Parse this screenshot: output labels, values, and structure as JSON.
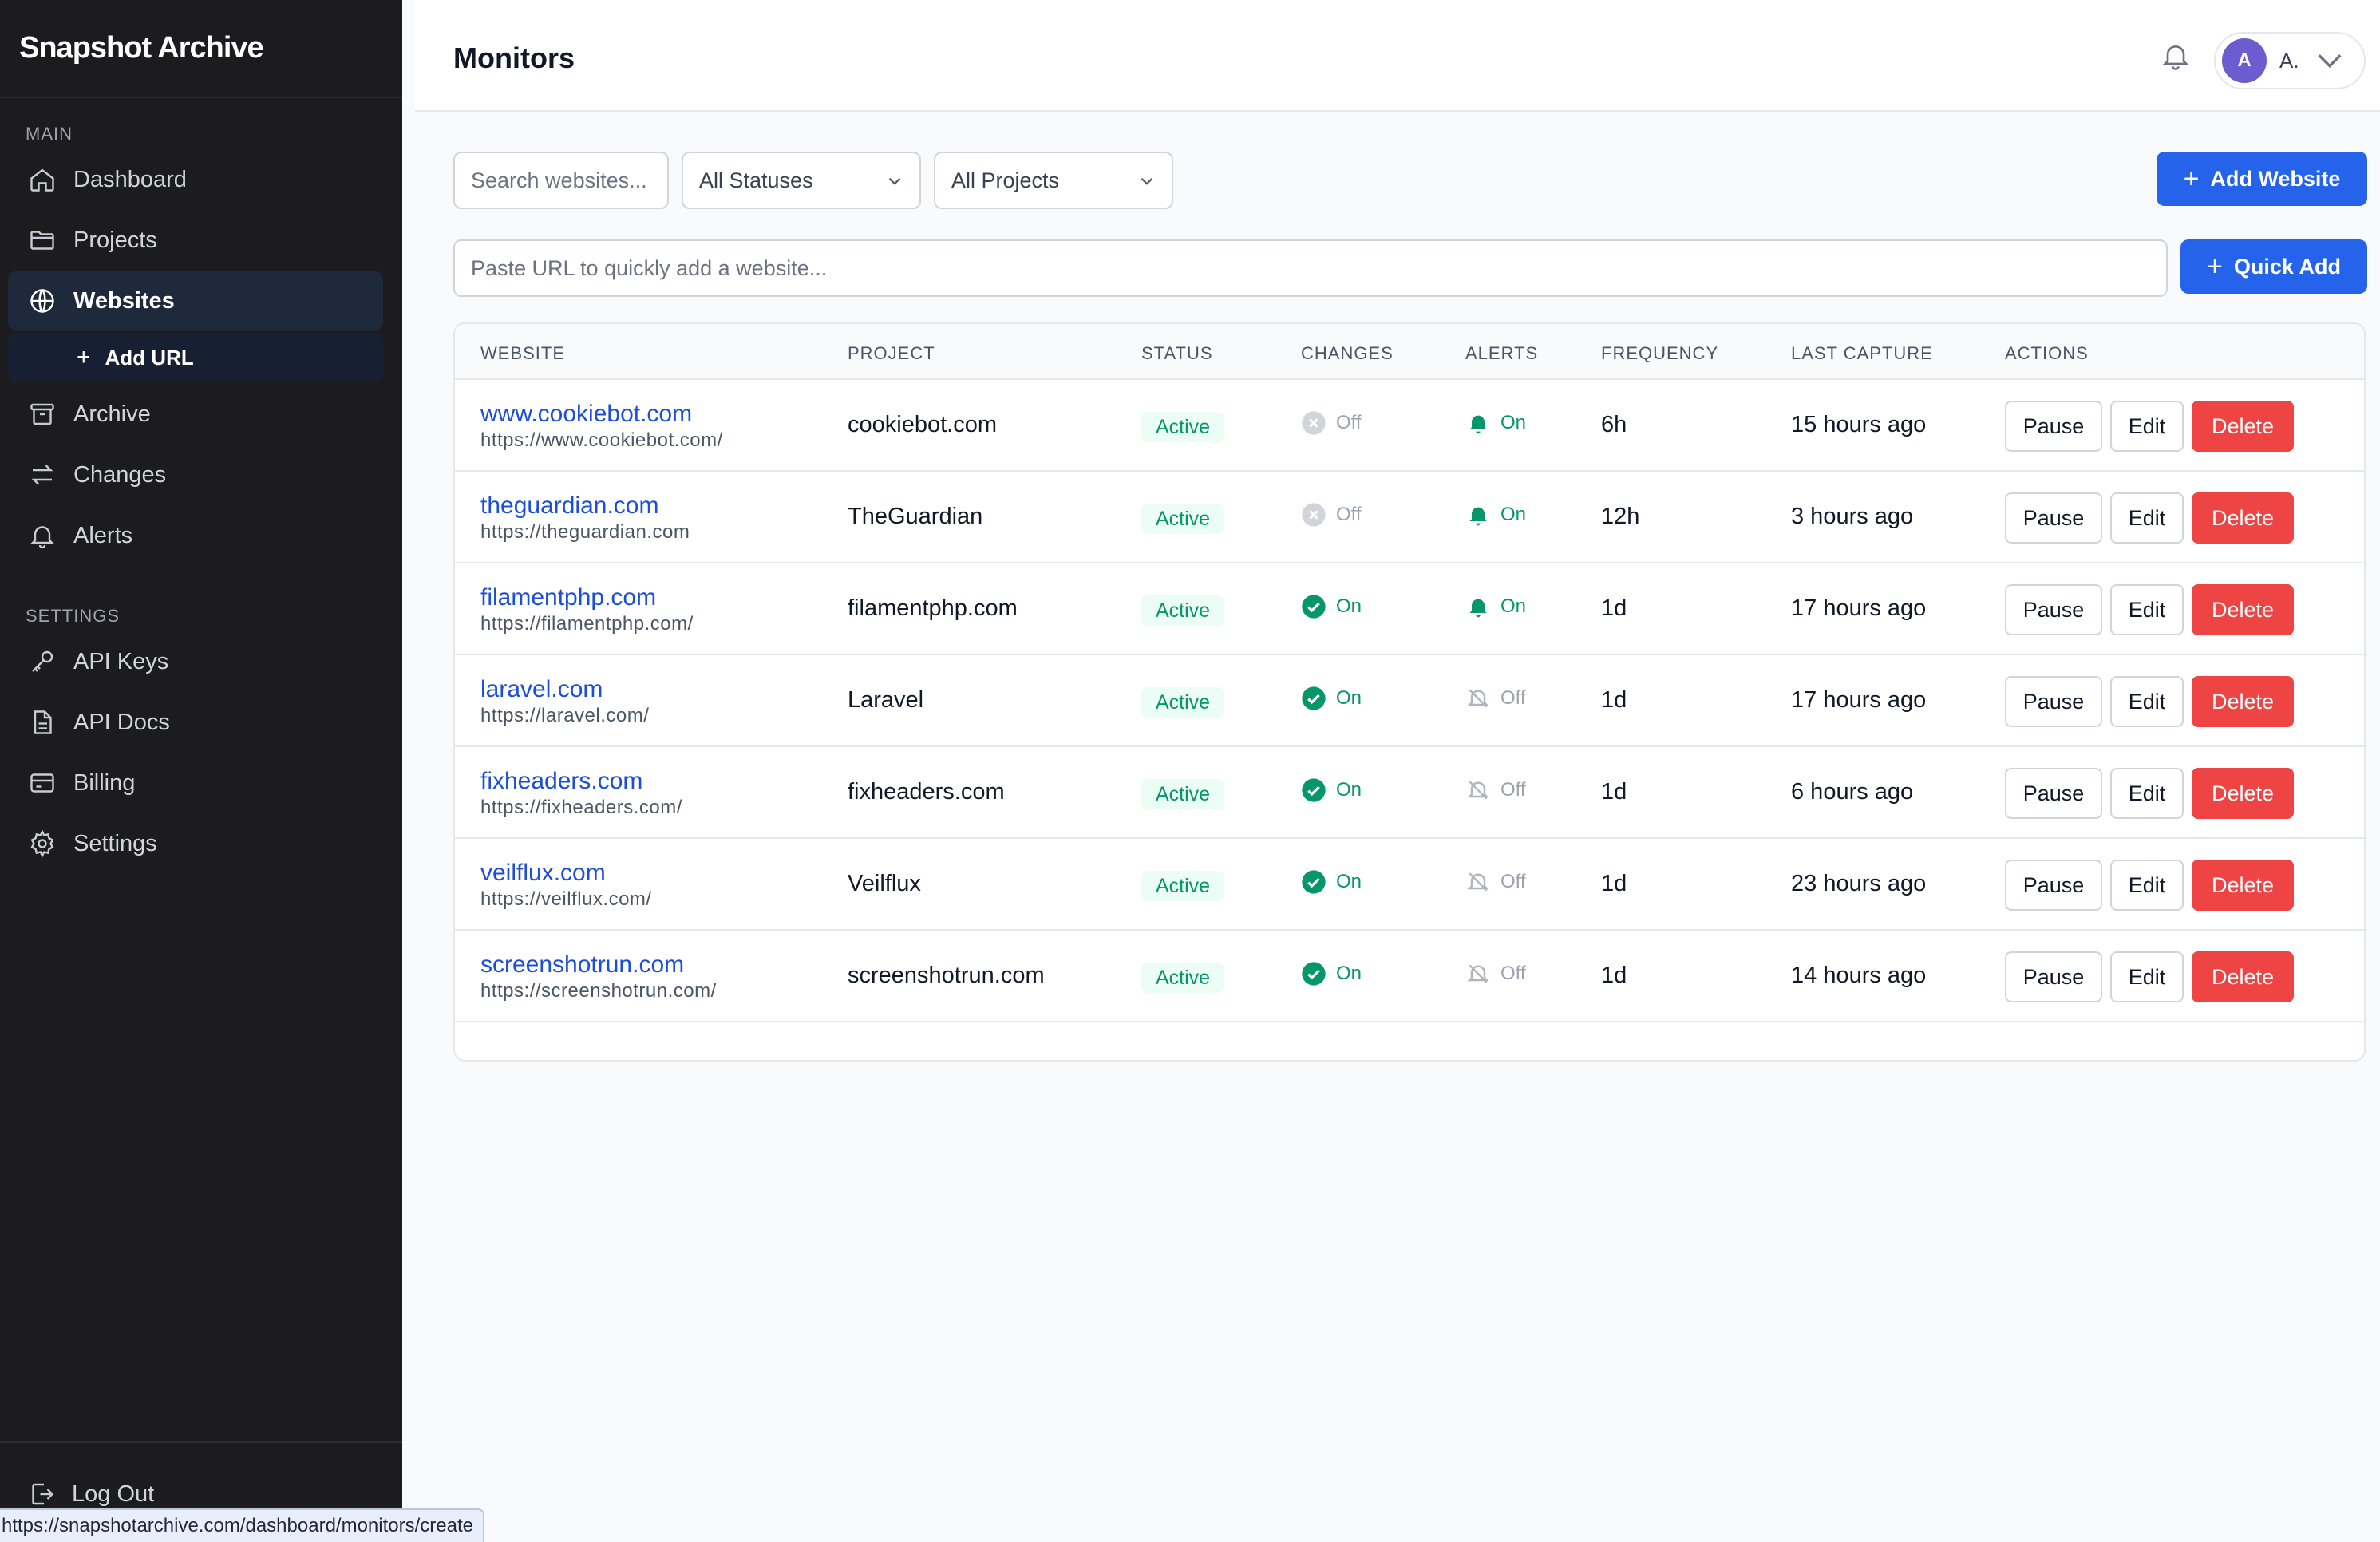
{
  "app": {
    "brand": "Snapshot Archive"
  },
  "sidebar": {
    "main_label": "MAIN",
    "settings_label": "SETTINGS",
    "main_items": [
      {
        "label": "Dashboard",
        "icon": "home-icon"
      },
      {
        "label": "Projects",
        "icon": "folder-icon"
      },
      {
        "label": "Websites",
        "icon": "globe-icon",
        "active": true
      }
    ],
    "sub_item": {
      "label": "Add URL"
    },
    "more_items": [
      {
        "label": "Archive",
        "icon": "archive-icon"
      },
      {
        "label": "Changes",
        "icon": "arrows-icon"
      },
      {
        "label": "Alerts",
        "icon": "bell-icon"
      }
    ],
    "settings_items": [
      {
        "label": "API Keys",
        "icon": "key-icon"
      },
      {
        "label": "API Docs",
        "icon": "document-icon"
      },
      {
        "label": "Billing",
        "icon": "card-icon"
      },
      {
        "label": "Settings",
        "icon": "gear-icon"
      }
    ],
    "logout_label": "Log Out"
  },
  "statusbar": {
    "url": "https://snapshotarchive.com/dashboard/monitors/create"
  },
  "header": {
    "title": "Monitors",
    "user_initial": "A",
    "user_name": "A."
  },
  "filters": {
    "search_placeholder": "Search websites...",
    "status_select": "All Statuses",
    "project_select": "All Projects",
    "add_website_label": "Add Website",
    "quick_add_placeholder": "Paste URL to quickly add a website...",
    "quick_add_label": "Quick Add"
  },
  "table": {
    "headers": [
      "WEBSITE",
      "PROJECT",
      "STATUS",
      "CHANGES",
      "ALERTS",
      "FREQUENCY",
      "LAST CAPTURE",
      "ACTIONS"
    ],
    "actions": {
      "pause": "Pause",
      "edit": "Edit",
      "delete": "Delete"
    },
    "rows": [
      {
        "name": "www.cookiebot.com",
        "url": "https://www.cookiebot.com/",
        "project": "cookiebot.com",
        "status": "Active",
        "changes": "Off",
        "alerts": "On",
        "frequency": "6h",
        "last_capture": "15 hours ago"
      },
      {
        "name": "theguardian.com",
        "url": "https://theguardian.com",
        "project": "TheGuardian",
        "status": "Active",
        "changes": "Off",
        "alerts": "On",
        "frequency": "12h",
        "last_capture": "3 hours ago"
      },
      {
        "name": "filamentphp.com",
        "url": "https://filamentphp.com/",
        "project": "filamentphp.com",
        "status": "Active",
        "changes": "On",
        "alerts": "On",
        "frequency": "1d",
        "last_capture": "17 hours ago"
      },
      {
        "name": "laravel.com",
        "url": "https://laravel.com/",
        "project": "Laravel",
        "status": "Active",
        "changes": "On",
        "alerts": "Off",
        "frequency": "1d",
        "last_capture": "17 hours ago"
      },
      {
        "name": "fixheaders.com",
        "url": "https://fixheaders.com/",
        "project": "fixheaders.com",
        "status": "Active",
        "changes": "On",
        "alerts": "Off",
        "frequency": "1d",
        "last_capture": "6 hours ago"
      },
      {
        "name": "veilflux.com",
        "url": "https://veilflux.com/",
        "project": "Veilflux",
        "status": "Active",
        "changes": "On",
        "alerts": "Off",
        "frequency": "1d",
        "last_capture": "23 hours ago"
      },
      {
        "name": "screenshotrun.com",
        "url": "https://screenshotrun.com/",
        "project": "screenshotrun.com",
        "status": "Active",
        "changes": "On",
        "alerts": "Off",
        "frequency": "1d",
        "last_capture": "14 hours ago"
      }
    ]
  },
  "colors": {
    "sidebar_bg": "#1c1c1e",
    "accent": "#2563eb",
    "active_green": "#059669",
    "delete_red": "#ef4444",
    "link_blue": "#1d4ed8"
  }
}
